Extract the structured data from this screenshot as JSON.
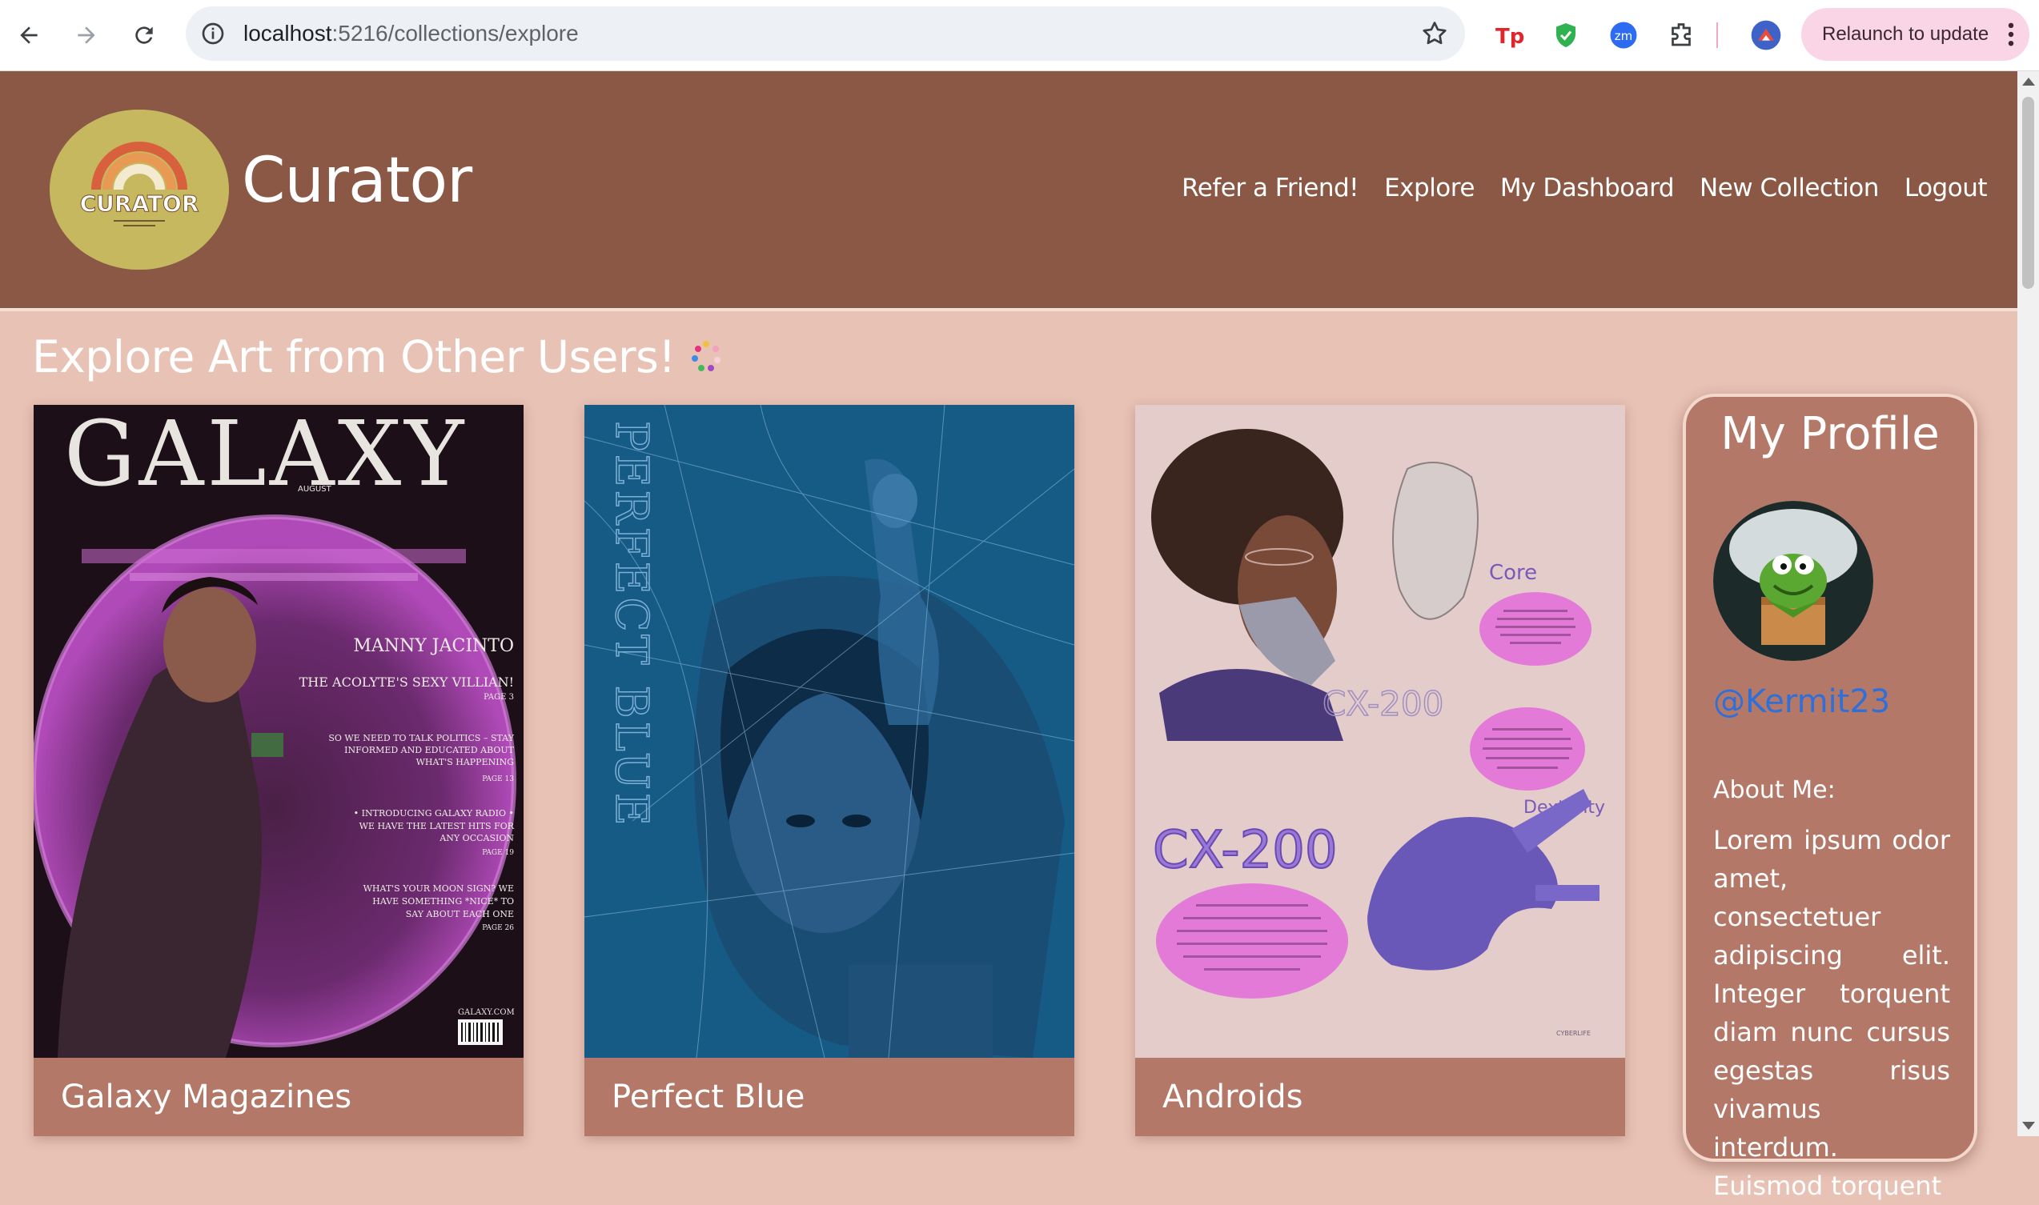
{
  "browser": {
    "url_host": "localhost",
    "url_path": ":5216/collections/explore",
    "relaunch_label": "Relaunch to update"
  },
  "site": {
    "title": "Curator",
    "logo_text": "CURATOR",
    "nav": [
      "Refer a Friend!",
      "Explore",
      "My Dashboard",
      "New Collection",
      "Logout"
    ]
  },
  "main": {
    "heading": "Explore Art from Other Users!",
    "collections": [
      {
        "title": "Galaxy Magazines",
        "art_name": "galaxy-magazine-cover"
      },
      {
        "title": "Perfect Blue",
        "art_name": "perfect-blue-poster"
      },
      {
        "title": "Androids",
        "art_name": "cx-200-android-sheet"
      }
    ]
  },
  "art_text": {
    "galaxy": {
      "masthead": "GALAXY",
      "month": "AUGUST",
      "cover_lines": [
        "MANNY JACINTO",
        "THE ACOLYTE'S SEXY VILLIAN!",
        "PAGE 3",
        "SO WE NEED TO TALK POLITICS – STAY",
        "INFORMED AND EDUCATED ABOUT",
        "WHAT'S HAPPENING",
        "PAGE 13",
        "• INTRODUCING GALAXY RADIO •",
        "WE HAVE THE LATEST HITS FOR",
        "ANY OCCASION",
        "PAGE 19",
        "WHAT'S YOUR MOON SIGN? WE",
        "HAVE SOMETHING *NICE* TO",
        "SAY ABOUT EACH ONE",
        "PAGE 26"
      ],
      "site": "GALAXY.COM"
    },
    "perfect_blue": {
      "title_vertical": "PERFECT BLUE"
    },
    "androids": {
      "model": "CX-200",
      "label_core": "Core",
      "label_dexterity": "Dexterity",
      "brand": "CYBERLIFE"
    }
  },
  "profile": {
    "heading": "My Profile",
    "username": "@Kermit23",
    "about_label": "About Me:",
    "about_text": "Lorem ipsum odor amet, consectetuer adipiscing elit. Integer torquent diam nunc cursus egestas risus vivamus interdum. Euismod torquent"
  },
  "colors": {
    "header_bg": "#8b5846",
    "page_bg": "#e8c2b5",
    "card_bg": "#b47868",
    "logo_bg": "#c5b85f",
    "username_link": "#2f6fd8",
    "relaunch_bg": "#f9d5e5"
  }
}
